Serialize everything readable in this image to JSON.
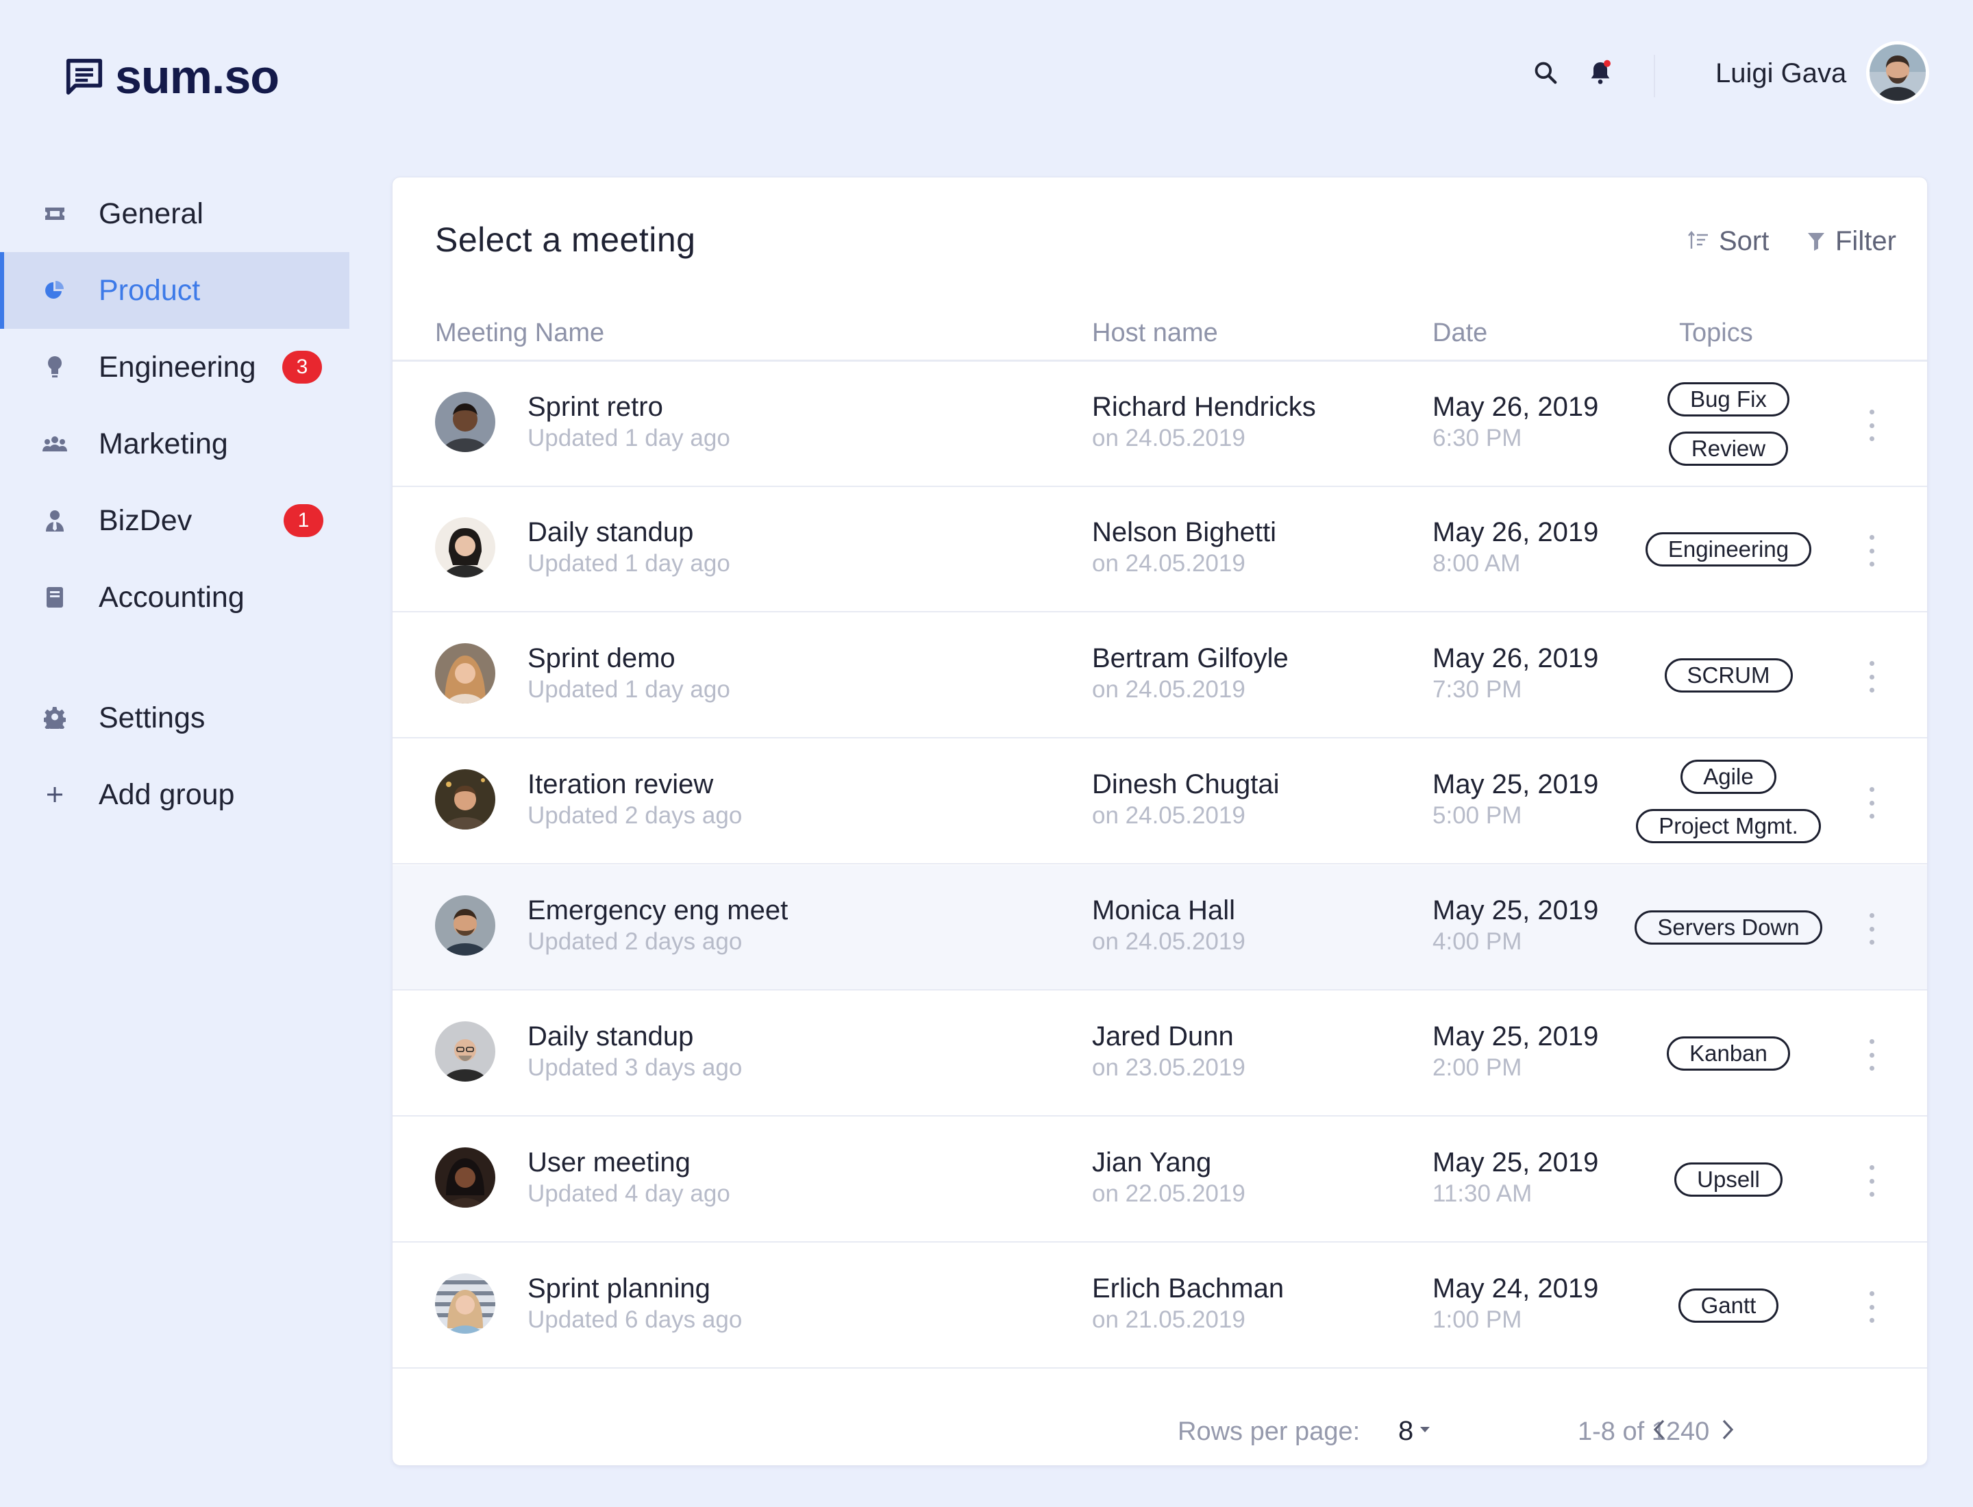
{
  "app": {
    "logo_text": "sum.so",
    "accent": "#3d7ae8",
    "badge_color": "#e8272f"
  },
  "header": {
    "user_name": "Luigi Gava",
    "search_icon": "search-icon",
    "bell_icon": "bell-icon",
    "notification_dot": "#e8272f"
  },
  "sidebar": {
    "items": [
      {
        "label": "General",
        "icon": "ticket-icon",
        "badge": ""
      },
      {
        "label": "Product",
        "icon": "pie-chart-icon",
        "badge": "",
        "active": true
      },
      {
        "label": "Engineering",
        "icon": "lightbulb-icon",
        "badge": "3"
      },
      {
        "label": "Marketing",
        "icon": "people-icon",
        "badge": ""
      },
      {
        "label": "BizDev",
        "icon": "person-tie-icon",
        "badge": "1"
      },
      {
        "label": "Accounting",
        "icon": "book-icon",
        "badge": ""
      }
    ],
    "settings_label": "Settings",
    "add_group_label": "Add group"
  },
  "main": {
    "title": "Select a meeting",
    "sort_label": "Sort",
    "filter_label": "Filter",
    "columns": {
      "meeting": "Meeting Name",
      "host": "Host name",
      "date": "Date",
      "topics": "Topics"
    },
    "rows": [
      {
        "name": "Sprint retro",
        "updated": "Updated 1 day ago",
        "host": "Richard Hendricks",
        "host_date": "on 24.05.2019",
        "date": "May 26, 2019",
        "time": "6:30 PM",
        "topics": [
          "Bug Fix",
          "Review"
        ]
      },
      {
        "name": "Daily standup",
        "updated": "Updated 1 day ago",
        "host": "Nelson Bighetti",
        "host_date": "on 24.05.2019",
        "date": "May 26, 2019",
        "time": "8:00 AM",
        "topics": [
          "Engineering"
        ]
      },
      {
        "name": "Sprint demo",
        "updated": "Updated 1 day ago",
        "host": "Bertram Gilfoyle",
        "host_date": "on 24.05.2019",
        "date": "May 26, 2019",
        "time": "7:30 PM",
        "topics": [
          "SCRUM"
        ]
      },
      {
        "name": "Iteration review",
        "updated": "Updated 2 days ago",
        "host": "Dinesh Chugtai",
        "host_date": "on 24.05.2019",
        "date": "May 25, 2019",
        "time": "5:00 PM",
        "topics": [
          "Agile",
          "Project Mgmt."
        ]
      },
      {
        "name": "Emergency eng meet",
        "updated": "Updated 2 days ago",
        "host": "Monica Hall",
        "host_date": "on 24.05.2019",
        "date": "May 25, 2019",
        "time": "4:00 PM",
        "topics": [
          "Servers Down"
        ]
      },
      {
        "name": "Daily standup",
        "updated": "Updated 3 days ago",
        "host": "Jared Dunn",
        "host_date": "on 23.05.2019",
        "date": "May 25, 2019",
        "time": "2:00 PM",
        "topics": [
          "Kanban"
        ]
      },
      {
        "name": "User meeting",
        "updated": "Updated 4 day ago",
        "host": "Jian Yang",
        "host_date": "on 22.05.2019",
        "date": "May 25, 2019",
        "time": "11:30 AM",
        "topics": [
          "Upsell"
        ]
      },
      {
        "name": "Sprint planning",
        "updated": "Updated 6 days ago",
        "host": "Erlich Bachman",
        "host_date": "on 21.05.2019",
        "date": "May 24, 2019",
        "time": "1:00 PM",
        "topics": [
          "Gantt"
        ]
      }
    ]
  },
  "footer": {
    "rows_per_page_label": "Rows per page:",
    "rows_per_page_value": "8",
    "range": "1-8 of 1240"
  }
}
